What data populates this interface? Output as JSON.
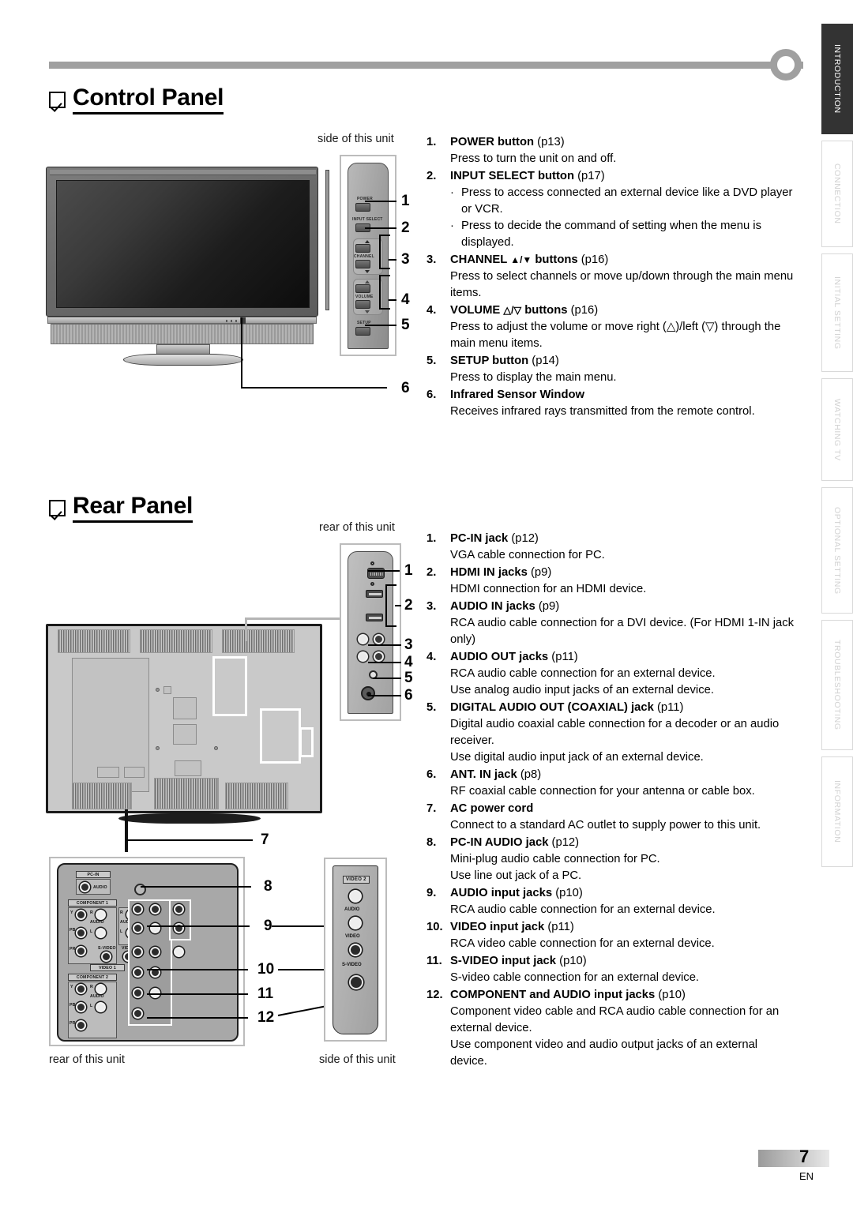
{
  "page": {
    "number": "7",
    "lang_code": "EN"
  },
  "tabs": [
    {
      "label": "INTRODUCTION",
      "active": true
    },
    {
      "label": "CONNECTION",
      "active": false
    },
    {
      "label": "INITIAL  SETTING",
      "active": false
    },
    {
      "label": "WATCHING  TV",
      "active": false
    },
    {
      "label": "OPTIONAL  SETTING",
      "active": false
    },
    {
      "label": "TROUBLESHOOTING",
      "active": false
    },
    {
      "label": "INFORMATION",
      "active": false
    }
  ],
  "control_panel": {
    "heading": "Control Panel",
    "caption_side": "side of this unit",
    "diagram_labels": {
      "power": "POWER",
      "input_select": "INPUT SELECT",
      "channel": "CHANNEL",
      "volume": "VOLUME"
    },
    "setup_label": "SETUP",
    "callouts": [
      "1",
      "2",
      "3",
      "4",
      "5",
      "6"
    ],
    "items": [
      {
        "index": "1.",
        "title": "POWER button",
        "page_ref": "(p13)",
        "desc": [
          "Press to turn the unit on and off."
        ],
        "bullets": []
      },
      {
        "index": "2.",
        "title": "INPUT SELECT button",
        "page_ref": "(p17)",
        "desc": [],
        "bullets": [
          "Press to access connected an external device like a DVD player or VCR.",
          "Press to decide the command of setting when the menu is displayed."
        ]
      },
      {
        "index": "3.",
        "title_pre": "CHANNEL ",
        "title_sym": "▲/▼",
        "title_post": " buttons",
        "page_ref": "(p16)",
        "desc": [
          "Press to select channels or move up/down through the main menu items."
        ],
        "bullets": []
      },
      {
        "index": "4.",
        "title_pre": "VOLUME ",
        "title_sym": "△/▽",
        "title_post": " buttons",
        "page_ref": "(p16)",
        "desc": [
          "Press to adjust the volume or move right (△)/left (▽) through the main menu items."
        ],
        "bullets": []
      },
      {
        "index": "5.",
        "title": "SETUP button",
        "page_ref": "(p14)",
        "desc": [
          "Press to display the main menu."
        ],
        "bullets": []
      },
      {
        "index": "6.",
        "title": "Infrared Sensor Window",
        "page_ref": "",
        "desc": [
          "Receives infrared rays transmitted from the remote control."
        ],
        "bullets": []
      }
    ]
  },
  "rear_panel": {
    "heading": "Rear Panel",
    "caption_rear_top": "rear of this unit",
    "caption_rear_bottom": "rear of this unit",
    "caption_side_bottom": "side of this unit",
    "callouts_top": [
      "1",
      "2",
      "3",
      "4",
      "5",
      "6"
    ],
    "callout_cord": "7",
    "callouts_bottom": [
      "8",
      "9",
      "10",
      "11",
      "12"
    ],
    "diagram_labels": {
      "pc_in": "PC-IN",
      "pc_in_audio": "AUDIO",
      "component1": "COMPONENT 1",
      "component2": "COMPONENT 2",
      "y": "Y",
      "pb": "PB",
      "pr": "PR",
      "audio": "AUDIO",
      "r": "R",
      "l": "L",
      "s_video": "S-VIDEO",
      "video": "VIDEO",
      "video1": "VIDEO 1",
      "video2": "VIDEO 2"
    },
    "items": [
      {
        "index": "1.",
        "title": "PC-IN jack",
        "page_ref": "(p12)",
        "desc": [
          "VGA cable connection for PC."
        ]
      },
      {
        "index": "2.",
        "title": "HDMI IN jacks",
        "page_ref": "(p9)",
        "desc": [
          "HDMI connection for an HDMI device."
        ]
      },
      {
        "index": "3.",
        "title": "AUDIO IN jacks",
        "page_ref": "(p9)",
        "desc": [
          "RCA audio cable connection for a DVI device. (For HDMI 1-IN jack only)"
        ]
      },
      {
        "index": "4.",
        "title": "AUDIO OUT jacks",
        "page_ref": "(p11)",
        "desc": [
          "RCA audio cable connection for an external device.",
          "Use analog audio input jacks of an external device."
        ]
      },
      {
        "index": "5.",
        "title": "DIGITAL AUDIO OUT (COAXIAL) jack",
        "page_ref": "(p11)",
        "desc": [
          "Digital audio coaxial cable connection for a decoder or an audio receiver.",
          "Use digital audio input jack of an external device."
        ]
      },
      {
        "index": "6.",
        "title": "ANT. IN jack",
        "page_ref": "(p8)",
        "desc": [
          "RF coaxial cable connection for your antenna or cable box."
        ]
      },
      {
        "index": "7.",
        "title": "AC power cord",
        "page_ref": "",
        "desc": [
          "Connect to a standard AC outlet to supply power to this unit."
        ]
      },
      {
        "index": "8.",
        "title": "PC-IN AUDIO jack",
        "page_ref": "(p12)",
        "desc": [
          "Mini-plug audio cable connection for PC.",
          "Use line out jack of a PC."
        ]
      },
      {
        "index": "9.",
        "title": "AUDIO input jacks",
        "page_ref": "(p10)",
        "desc": [
          "RCA audio cable connection for an external device."
        ]
      },
      {
        "index": "10.",
        "title": "VIDEO input jack",
        "page_ref": "(p11)",
        "desc": [
          "RCA video cable connection for an external device."
        ]
      },
      {
        "index": "11.",
        "title": "S-VIDEO input jack",
        "page_ref": "(p10)",
        "desc": [
          "S-video cable connection for an external device."
        ]
      },
      {
        "index": "12.",
        "title": "COMPONENT and AUDIO input jacks",
        "page_ref": "(p10)",
        "desc": [
          "Component video cable and RCA audio cable connection for an external device.",
          "Use component video and audio output jacks of an external device."
        ]
      }
    ]
  }
}
